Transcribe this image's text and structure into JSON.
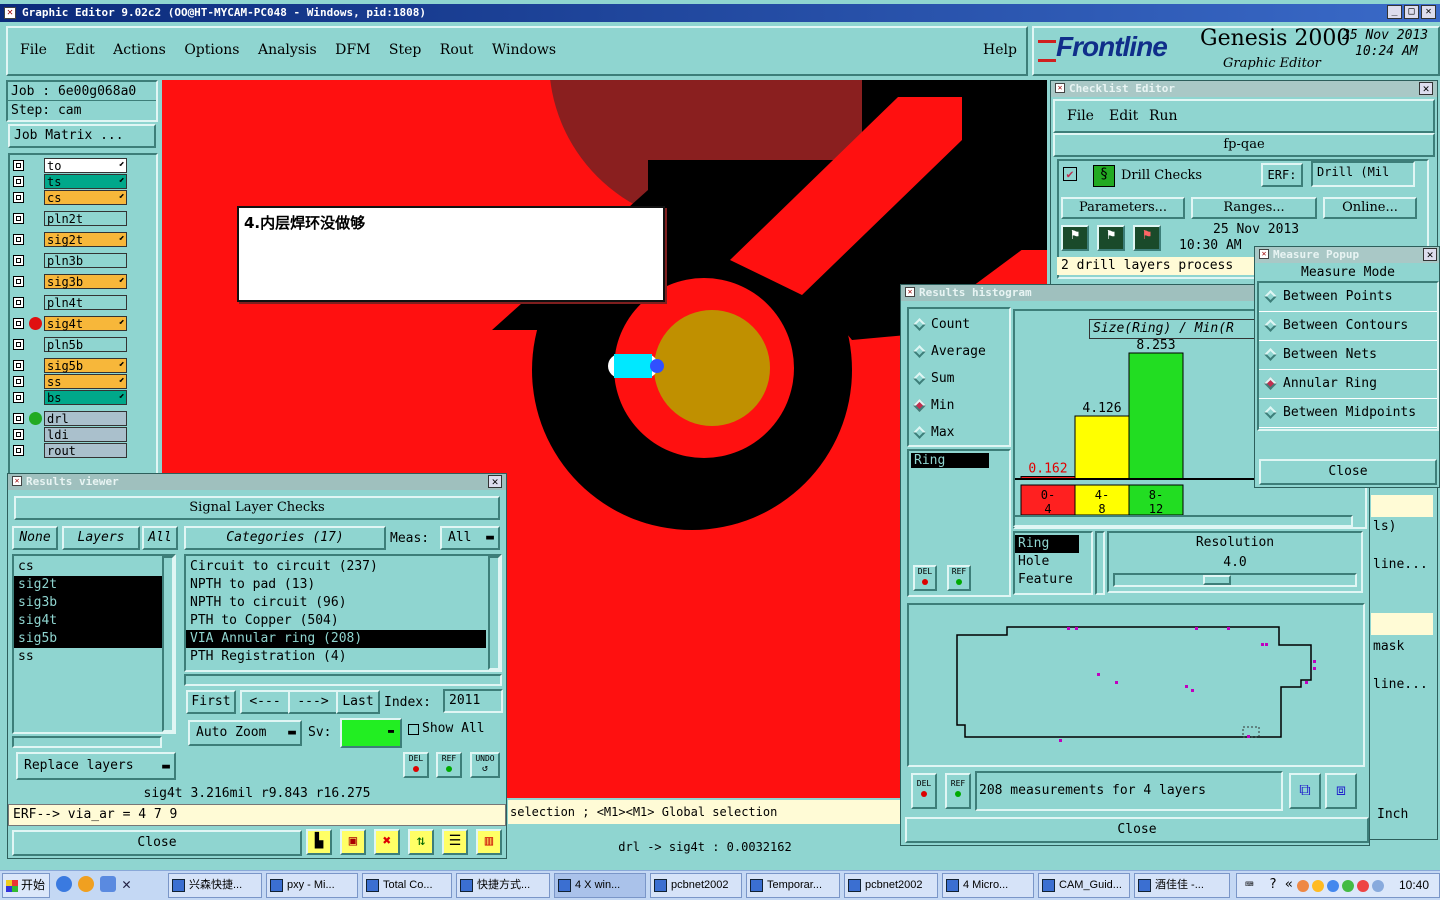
{
  "app": {
    "title": "Graphic Editor 9.02c2 (OO@HT-MYCAM-PC048 - Windows, pid:1808)",
    "menu": [
      "File",
      "Edit",
      "Actions",
      "Options",
      "Analysis",
      "DFM",
      "Step",
      "Rout",
      "Windows"
    ],
    "help": "Help",
    "brand": "Frontline",
    "product": "Genesis 2000",
    "subtitle": "Graphic Editor",
    "date": "25 Nov 2013",
    "time": "10:24 AM"
  },
  "job": {
    "job_label": "Job : 6e00g068a0",
    "step_label": "Step: cam",
    "matrix_button": "Job Matrix ..."
  },
  "layers": [
    {
      "name": "to",
      "color": "#ffffff"
    },
    {
      "name": "ts",
      "color": "#00a88a"
    },
    {
      "name": "cs",
      "color": "#f7b73a"
    },
    {
      "name": "pln2t",
      "color": "#8fd5d0"
    },
    {
      "name": "sig2t",
      "color": "#f7b73a"
    },
    {
      "name": "pln3b",
      "color": "#8fd5d0"
    },
    {
      "name": "sig3b",
      "color": "#f7b73a"
    },
    {
      "name": "pln4t",
      "color": "#8fd5d0"
    },
    {
      "name": "sig4t",
      "color": "#f7b73a"
    },
    {
      "name": "pln5b",
      "color": "#8fd5d0"
    },
    {
      "name": "sig5b",
      "color": "#f7b73a"
    },
    {
      "name": "ss",
      "color": "#f7b73a"
    },
    {
      "name": "bs",
      "color": "#00a88a"
    },
    {
      "name": "drl",
      "color": "#aac0cc"
    },
    {
      "name": "ldi",
      "color": "#aac0cc"
    },
    {
      "name": "rout",
      "color": "#aac0cc"
    }
  ],
  "note": {
    "text": "4.内层焊环没做够"
  },
  "results_viewer": {
    "title": "Results viewer",
    "header": "Signal Layer Checks",
    "none_btn": "None",
    "layers_btn": "Layers",
    "all_btn": "All",
    "categories_btn": "Categories (17)",
    "meas_label": "Meas:",
    "meas_value": "All",
    "layer_list": [
      "cs",
      "sig2t",
      "sig3b",
      "sig4t",
      "sig5b",
      "ss"
    ],
    "selected_layers": [
      "sig2t",
      "sig3b",
      "sig4t",
      "sig5b"
    ],
    "categories": [
      "Circuit to circuit (237)",
      "NPTH to pad (13)",
      "NPTH to circuit (96)",
      "PTH to Copper (504)",
      "VIA Annular ring (208)",
      "PTH Registration (4)"
    ],
    "selected_category": "VIA Annular ring (208)",
    "first": "First",
    "prev": "<---",
    "next": "--->",
    "last": "Last",
    "index_label": "Index:",
    "index_value": "2011",
    "auto_zoom": "Auto Zoom",
    "sv_label": "Sv:",
    "show_all": "Show All",
    "replace_layers": "Replace layers",
    "status_line": "sig4t 3.216mil   r9.843   r16.275",
    "erf_line": "ERF--> via_ar = 4 7 9",
    "close": "Close",
    "del": "DEL",
    "ref": "REF",
    "undo": "UNDO"
  },
  "checklist": {
    "title": "Checklist Editor",
    "menu": [
      "File",
      "Edit",
      "Run"
    ],
    "name": "fp-qae",
    "check_name": "Drill Checks",
    "erf_label": "ERF:",
    "erf_value": "Drill (Mil",
    "params": "Parameters...",
    "ranges": "Ranges...",
    "online": "Online...",
    "date": "25 Nov 2013",
    "time": "10:30 AM",
    "message": "2 drill layers process",
    "side_lines": [
      "ls)",
      "line...",
      "mask",
      "line..."
    ],
    "inch": "Inch"
  },
  "measure_popup": {
    "title": "Measure Popup",
    "header": "Measure Mode",
    "items": [
      "Between Points",
      "Between Contours",
      "Between Nets",
      "Annular Ring",
      "Between Midpoints"
    ],
    "selected": "Annular Ring",
    "close": "Close"
  },
  "histogram": {
    "title": "Results histogram",
    "options": [
      "Count",
      "Average",
      "Sum",
      "Min",
      "Max"
    ],
    "selected": "Min",
    "chart_title": "Size(Ring) / Min(R",
    "bars": [
      {
        "range": "0-4",
        "value": 0.162,
        "color": "#ff2020"
      },
      {
        "range": "4-8",
        "value": 4.126,
        "color": "#ffff00"
      },
      {
        "range": "8-12",
        "value": 8.253,
        "color": "#22dd22"
      }
    ],
    "bin_labels": [
      [
        "0-",
        "4"
      ],
      [
        "4-",
        "8"
      ],
      [
        "8-",
        "12"
      ]
    ],
    "left_list": [
      "Ring"
    ],
    "attr_list": [
      "Ring",
      "Hole",
      "Feature"
    ],
    "resolution_label": "Resolution",
    "resolution_value": "4.0",
    "summary": "208 measurements for 4 layers",
    "close": "Close",
    "del": "DEL",
    "ref": "REF"
  },
  "status": {
    "selection_hint": "selection ; <M1><M1> Global selection",
    "measure": "drl -> sig4t : 0.0032162"
  },
  "taskbar": {
    "start": "开始",
    "items": [
      "兴森快捷...",
      "pxy - Mi...",
      "Total Co...",
      "快捷方式...",
      "4 X win...",
      "pcbnet2002",
      "Temporar...",
      "pcbnet2002",
      "4 Micro...",
      "CAM_Guid...",
      "酒佳佳 -..."
    ],
    "clock": "10:40"
  },
  "colors": {
    "bg": "#8fd5d0",
    "copper": "#ff1010",
    "black": "#000000",
    "pad": "#c09000",
    "cyan": "#00e0ff",
    "title_active": "#0b2a7a"
  }
}
